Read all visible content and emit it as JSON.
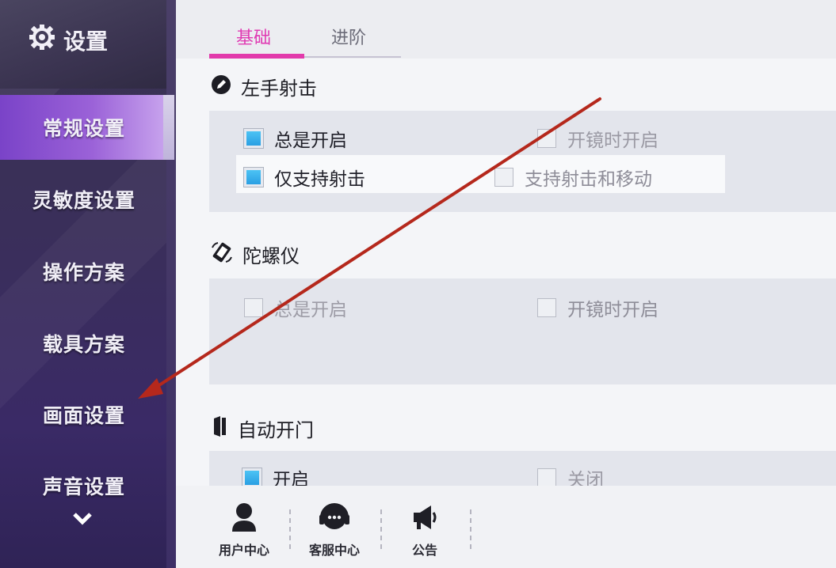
{
  "header": {
    "title": "设置"
  },
  "sidebar": {
    "items": [
      {
        "label": "常规设置",
        "active": true
      },
      {
        "label": "灵敏度设置"
      },
      {
        "label": "操作方案"
      },
      {
        "label": "载具方案"
      },
      {
        "label": "画面设置"
      },
      {
        "label": "声音设置"
      }
    ]
  },
  "tabs": [
    {
      "label": "基础",
      "active": true
    },
    {
      "label": "进阶"
    }
  ],
  "sections": {
    "left_hand_fire": {
      "title": "左手射击",
      "options": [
        {
          "label": "总是开启",
          "checked": true
        },
        {
          "label": "开镜时开启",
          "checked": false
        },
        {
          "label": "仅支持射击",
          "checked": true
        },
        {
          "label": "支持射击和移动",
          "checked": false
        }
      ]
    },
    "gyroscope": {
      "title": "陀螺仪",
      "options": [
        {
          "label": "总是开启",
          "checked": false,
          "disabled": true
        },
        {
          "label": "开镜时开启",
          "checked": false
        }
      ]
    },
    "auto_door": {
      "title": "自动开门",
      "options": [
        {
          "label": "开启",
          "checked": true
        },
        {
          "label": "关闭",
          "checked": false
        }
      ]
    }
  },
  "toolbar": {
    "user_center": "用户中心",
    "service_center": "客服中心",
    "announcement": "公告"
  },
  "colors": {
    "accent_pink": "#e23aab",
    "active_menu": "#8a52d0",
    "checkbox_checked": "#3bb0ec",
    "annotation_arrow": "#b5281c"
  },
  "icons": {
    "logo": "gear-icon",
    "left_hand_fire": "pencil-circle-icon",
    "gyroscope": "gyroscope-icon",
    "auto_door": "door-icon",
    "scroll_down": "chevron-down-icon",
    "user_center": "user-icon",
    "service_center": "headset-icon",
    "announcement": "megaphone-icon"
  }
}
